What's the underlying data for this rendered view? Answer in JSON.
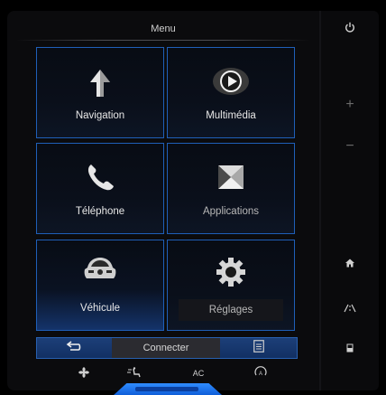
{
  "header": {
    "title": "Menu"
  },
  "tiles": {
    "navigation": {
      "label": "Navigation",
      "icon": "navigation-arrow-icon"
    },
    "multimedia": {
      "label": "Multimédia",
      "icon": "play-icon"
    },
    "telephone": {
      "label": "Téléphone",
      "icon": "phone-icon"
    },
    "applications": {
      "label": "Applications",
      "icon": "applications-icon"
    },
    "vehicle": {
      "label": "Véhicule",
      "icon": "car-icon"
    },
    "settings": {
      "label": "Réglages",
      "icon": "gear-icon"
    }
  },
  "bottom_bar": {
    "connect_label": "Connecter"
  },
  "climate": {
    "ac_label": "AC"
  },
  "sidebar": {
    "power": "power-icon",
    "volume_up": "+",
    "volume_down": "−",
    "home": "home-icon",
    "driving": "road-icon",
    "more": "screen-icon"
  },
  "colors": {
    "accent": "#1f5fb8",
    "glow": "#2f8cff",
    "background": "#0b0b0d"
  }
}
